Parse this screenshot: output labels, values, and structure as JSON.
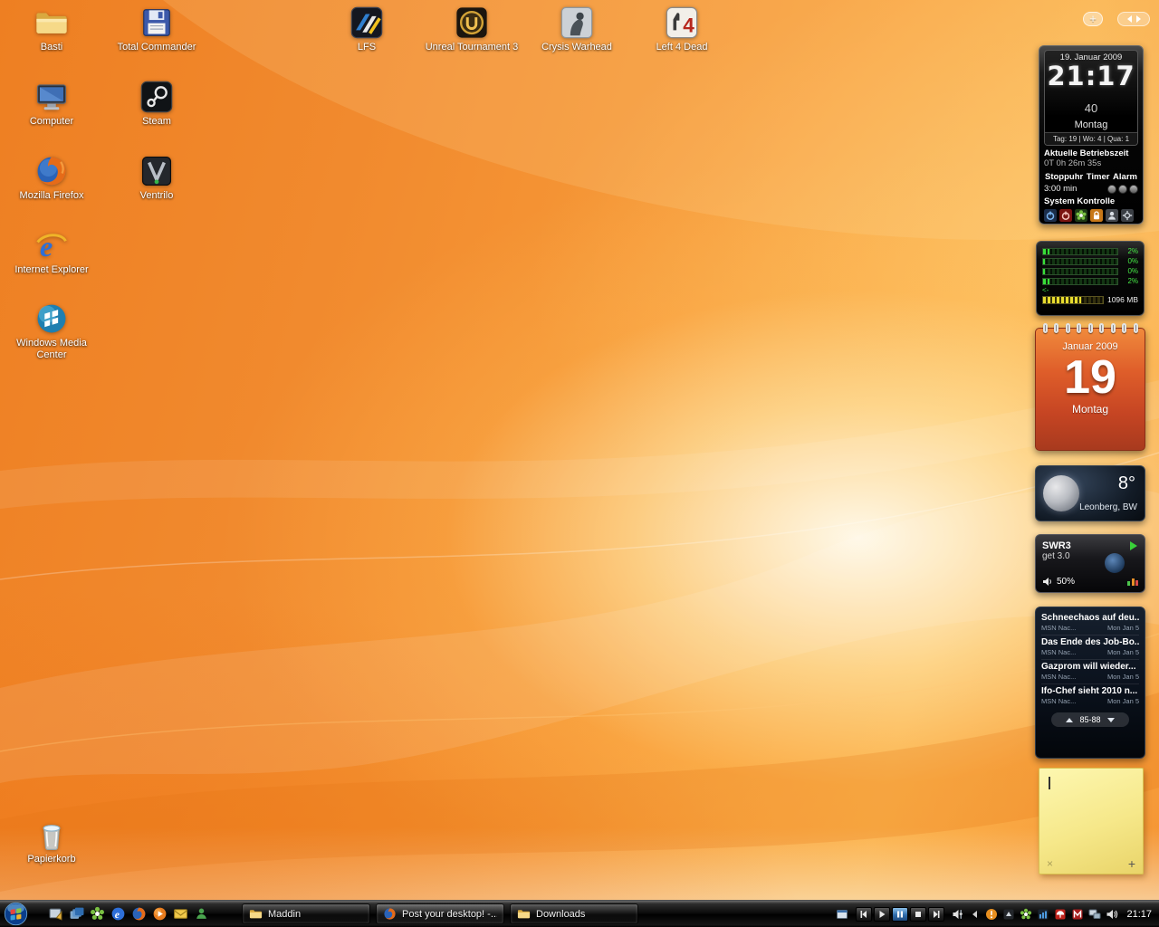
{
  "desktop": {
    "icons": [
      {
        "label": "Basti",
        "icon": "folder-icon"
      },
      {
        "label": "Total Commander",
        "icon": "floppy-disk-icon"
      },
      {
        "label": "LFS",
        "icon": "lfs-game-icon"
      },
      {
        "label": "Unreal Tournament 3",
        "icon": "ut3-game-icon"
      },
      {
        "label": "Crysis Warhead",
        "icon": "crysis-game-icon"
      },
      {
        "label": "Left 4 Dead",
        "icon": "l4d-game-icon"
      },
      {
        "label": "Computer",
        "icon": "computer-icon"
      },
      {
        "label": "Steam",
        "icon": "steam-icon"
      },
      {
        "label": "Mozilla Firefox",
        "icon": "firefox-icon"
      },
      {
        "label": "Ventrilo",
        "icon": "ventrilo-icon"
      },
      {
        "label": "Internet Explorer",
        "icon": "ie-icon"
      },
      {
        "label": "Windows Media Center",
        "icon": "media-center-icon"
      },
      {
        "label": "Papierkorb",
        "icon": "recycle-bin-icon"
      }
    ]
  },
  "sidebar_controls": {
    "add_label": "+"
  },
  "clock_gadget": {
    "date": "19. Januar 2009",
    "time": "21:17",
    "seconds": "40",
    "weekday": "Montag",
    "stats": "Tag: 19 |  Wo: 4 |  Qua: 1",
    "uptime_label": "Aktuelle Betriebszeit",
    "uptime_value": "0T 0h 26m 35s",
    "tabs": [
      "Stoppuhr",
      "Timer",
      "Alarm"
    ],
    "timer_value": "3:00 min",
    "system_label": "System Kontrolle",
    "system_icons": [
      "power-icon",
      "shutdown-icon",
      "logoff-flower-icon",
      "lock-icon",
      "user-switch-icon",
      "settings-icon"
    ]
  },
  "meter_gadget": {
    "bars": [
      {
        "value": "2%",
        "percent": 2
      },
      {
        "value": "0%",
        "percent": 0
      },
      {
        "value": "0%",
        "percent": 0
      },
      {
        "value": "2%",
        "percent": 2
      }
    ],
    "arrow": "<-",
    "memory": "1096 MB",
    "memory_percent": 64
  },
  "calendar_gadget": {
    "month": "Januar 2009",
    "day": "19",
    "weekday": "Montag"
  },
  "weather_gadget": {
    "temp": "8°",
    "location": "Leonberg, BW",
    "condition_icon": "moon-icon"
  },
  "radio_gadget": {
    "station": "SWR3",
    "program": "get 3.0",
    "volume": "50%"
  },
  "feed_gadget": {
    "items": [
      {
        "title": "Schneechaos auf deu...",
        "source": "MSN Nac...",
        "date": "Mon Jan 5"
      },
      {
        "title": "Das Ende des Job-Bo...",
        "source": "MSN Nac...",
        "date": "Mon Jan 5"
      },
      {
        "title": "Gazprom will wieder...",
        "source": "MSN Nac...",
        "date": "Mon Jan 5"
      },
      {
        "title": "Ifo-Chef sieht 2010 n...",
        "source": "MSN Nac...",
        "date": "Mon Jan 5"
      }
    ],
    "pagination": "85-88"
  },
  "note_gadget": {
    "close_label": "×",
    "add_label": "+"
  },
  "taskbar": {
    "tasks": [
      {
        "label": "Maddin",
        "icon": "folder-icon"
      },
      {
        "label": "Post your desktop! -...",
        "icon": "firefox-icon"
      },
      {
        "label": "Downloads",
        "icon": "folder-icon"
      }
    ],
    "clock": "21:17",
    "quick_launch_icons": [
      "show-desktop-icon",
      "switch-windows-icon",
      "icq-flower-icon",
      "ie-icon",
      "firefox-icon",
      "media-player-icon",
      "mail-icon",
      "messenger-icon"
    ],
    "tray_icon_names": [
      "window-icon",
      "media-prev-icon",
      "media-play-icon",
      "media-pause-icon",
      "media-stop-icon",
      "media-next-icon",
      "volume-slider-icon",
      "warning-icon",
      "app-icon",
      "icq-flower-icon",
      "chart-icon",
      "antivirus-icon",
      "messenger-m-icon",
      "network-icon",
      "volume-icon"
    ]
  },
  "icons": {
    "ie_letter": "e",
    "l4d_number": "4"
  }
}
